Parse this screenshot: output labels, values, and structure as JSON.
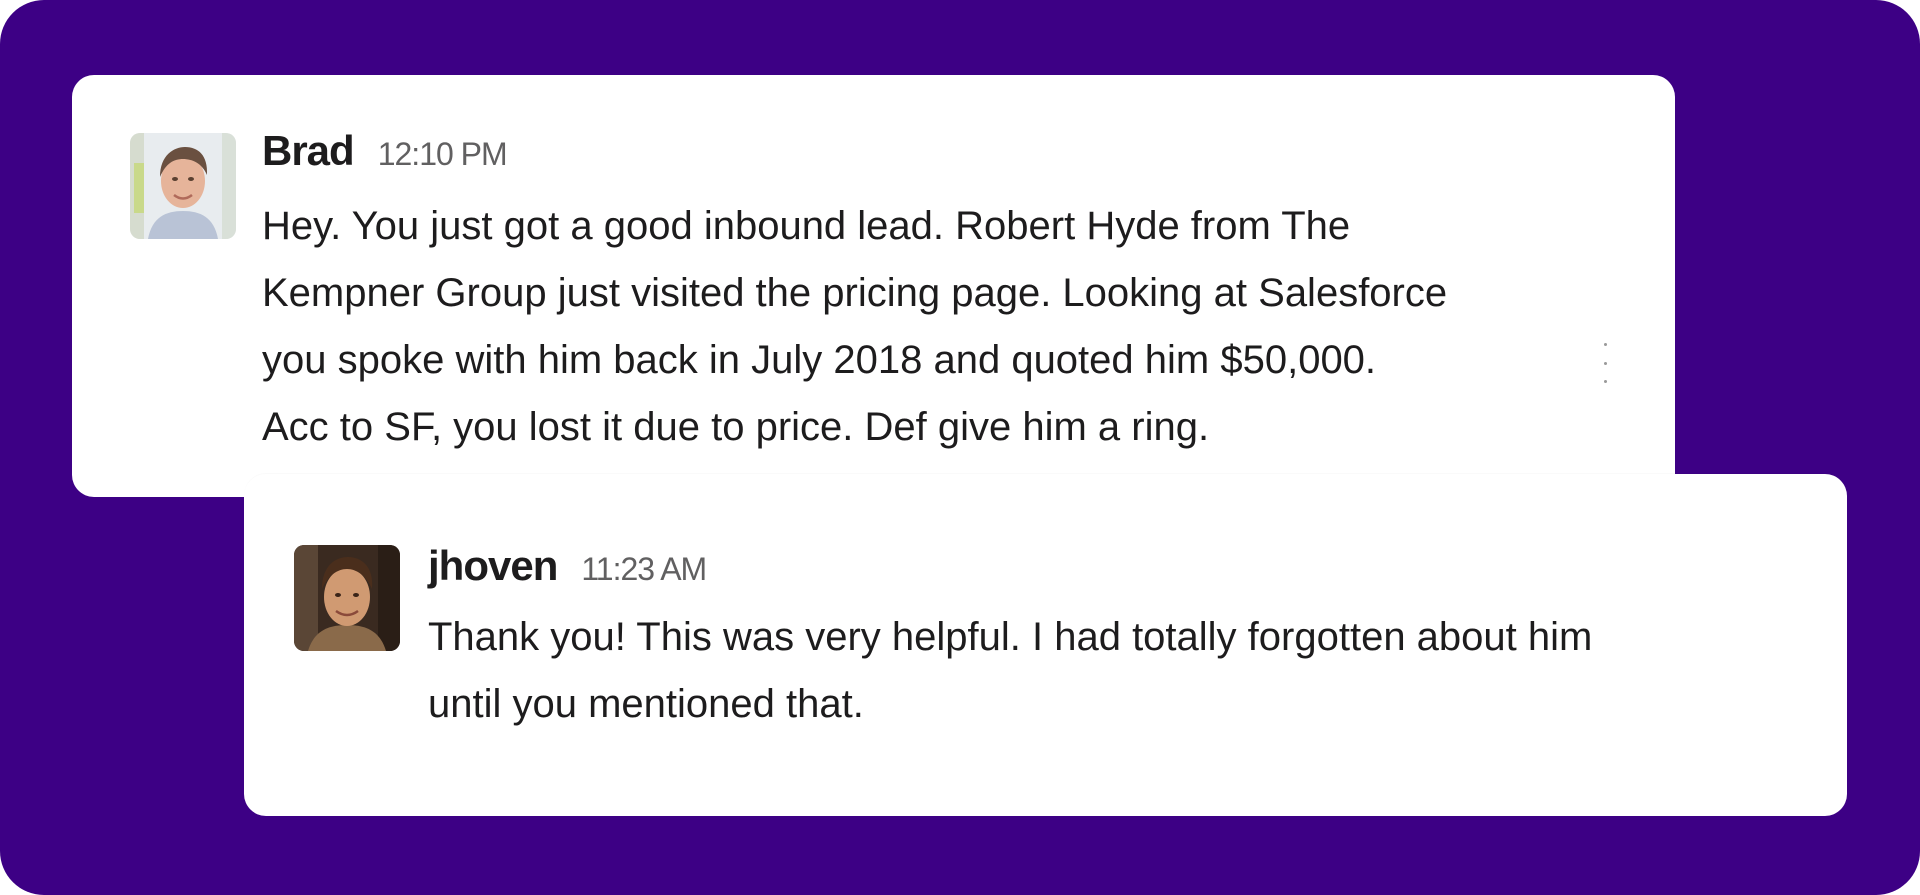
{
  "messages": [
    {
      "username": "Brad",
      "timestamp": "12:10 PM",
      "avatar_icon": "user-avatar-photo",
      "lines": [
        "Hey. You just got a good inbound lead. Robert Hyde from The",
        "Kempner Group just visited the pricing page. Looking at Salesforce",
        "you spoke with him back in July 2018 and quoted him $50,000.",
        "Acc to SF, you lost it due to price. Def give him a ring."
      ]
    },
    {
      "username": "jhoven",
      "timestamp": "11:23 AM",
      "avatar_icon": "user-avatar-photo",
      "lines": [
        "Thank you! This was very helpful. I had totally forgotten about him",
        "until you mentioned that."
      ]
    }
  ],
  "colors": {
    "background": "#3d0085",
    "card": "#ffffff",
    "text": "#1d1c1d",
    "timestamp": "#616061"
  }
}
